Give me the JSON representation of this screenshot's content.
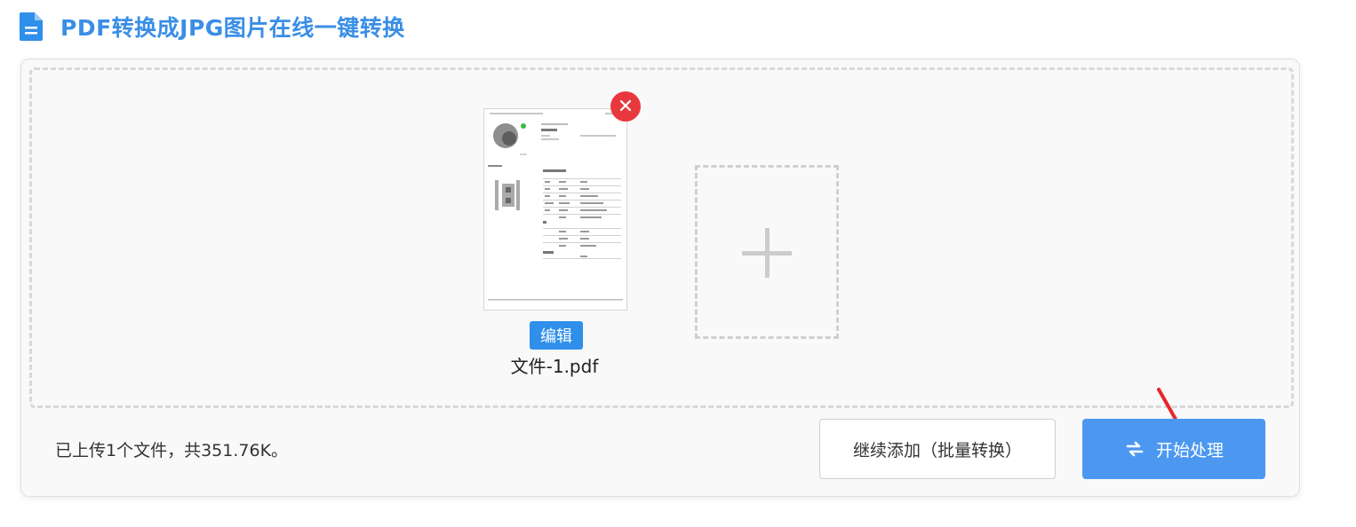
{
  "header": {
    "title": "PDF转换成JPG图片在线一键转换",
    "icon": "document-icon",
    "accent_color": "#3a8ee6"
  },
  "upload": {
    "file": {
      "name": "文件-1.pdf",
      "edit_label": "编辑",
      "remove_icon": "close-icon"
    },
    "add_tile_icon": "plus-icon",
    "status_text": "已上传1个文件，共351.76K。"
  },
  "actions": {
    "continue_label": "继续添加（批量转换）",
    "start_label": "开始处理",
    "start_icon": "swap-arrows-icon",
    "start_color": "#4c98f0"
  },
  "annotation": {
    "arrow_color": "#e8262a"
  }
}
